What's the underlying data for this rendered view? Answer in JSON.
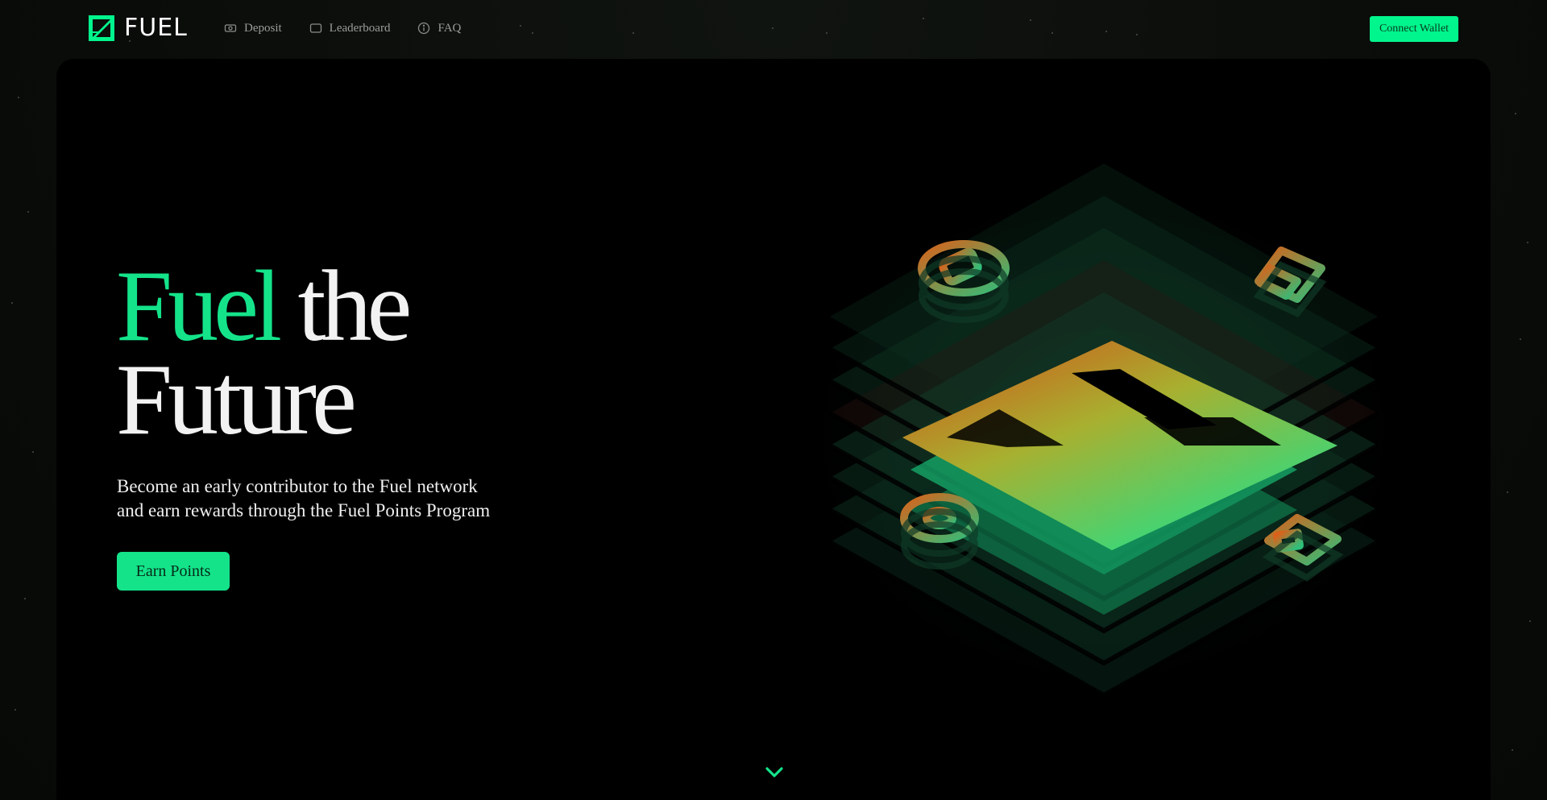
{
  "brand": {
    "name": "FUEL",
    "accent_color": "#00f58c",
    "logo_icon": "fuel-logo-icon"
  },
  "nav": {
    "items": [
      {
        "label": "Deposit",
        "icon": "cash-icon"
      },
      {
        "label": "Leaderboard",
        "icon": "board-icon"
      },
      {
        "label": "FAQ",
        "icon": "info-icon"
      }
    ]
  },
  "header": {
    "connect_label": "Connect Wallet"
  },
  "hero": {
    "headline_accent": "Fuel",
    "headline_rest": " the",
    "headline_line2": "Future",
    "subtitle_line1": "Become an early contributor to the Fuel network",
    "subtitle_line2": "and earn rewards through the Fuel Points Program",
    "cta_label": "Earn Points",
    "scroll_icon": "chevron-down-icon"
  },
  "colors": {
    "hero_background": "#000000",
    "cta_green": "#14e38a",
    "illustration_orange": "#d9621a",
    "illustration_green": "#1ee28c"
  }
}
